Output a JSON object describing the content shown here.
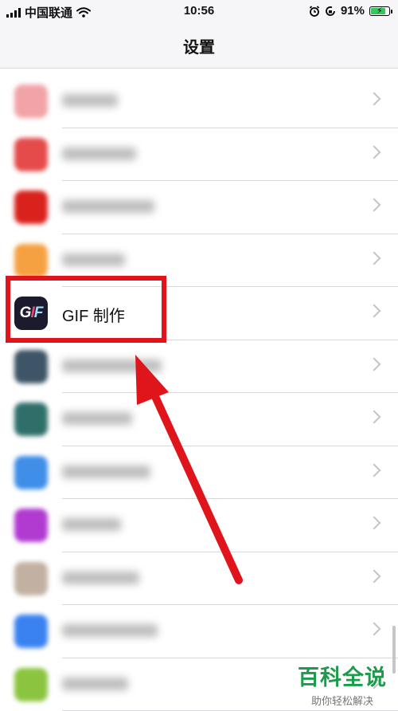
{
  "status_bar": {
    "carrier": "中国联通",
    "time": "10:56",
    "battery_percent": "91%",
    "battery_level": 0.91,
    "icons": [
      "signal-icon",
      "wifi-icon",
      "alarm-icon",
      "rotation-lock-icon",
      "battery-icon"
    ]
  },
  "nav": {
    "title": "设置"
  },
  "list": {
    "items": [
      {
        "label": "",
        "icon": "app-icon-blurred",
        "color": "#f2a3a8",
        "blurred": true
      },
      {
        "label": "",
        "icon": "app-icon-blurred",
        "color": "#e54b4b",
        "blurred": true
      },
      {
        "label": "",
        "icon": "app-icon-blurred",
        "color": "#d9221c",
        "blurred": true
      },
      {
        "label": "",
        "icon": "app-icon-blurred",
        "color": "#f5a142",
        "blurred": true
      },
      {
        "label": "GIF 制作",
        "icon": "gif-app-icon",
        "color": "#1c1b2e",
        "blurred": false
      },
      {
        "label": "",
        "icon": "app-icon-blurred",
        "color": "#3d5566",
        "blurred": true
      },
      {
        "label": "",
        "icon": "app-icon-blurred",
        "color": "#2f6f69",
        "blurred": true
      },
      {
        "label": "",
        "icon": "app-icon-blurred",
        "color": "#3f8ee8",
        "blurred": true
      },
      {
        "label": "",
        "icon": "app-icon-blurred",
        "color": "#b13ad1",
        "blurred": true
      },
      {
        "label": "",
        "icon": "app-icon-blurred",
        "color": "#c2b1a2",
        "blurred": true
      },
      {
        "label": "",
        "icon": "app-icon-blurred",
        "color": "#3a82f0",
        "blurred": true
      },
      {
        "label": "",
        "icon": "app-icon-blurred",
        "color": "#8bc53f",
        "blurred": true
      }
    ]
  },
  "watermark": {
    "title": "百科全说",
    "subtitle": "助你轻松解决"
  },
  "colors": {
    "highlight": "#e0141b",
    "watermark": "#1a9d4a"
  }
}
